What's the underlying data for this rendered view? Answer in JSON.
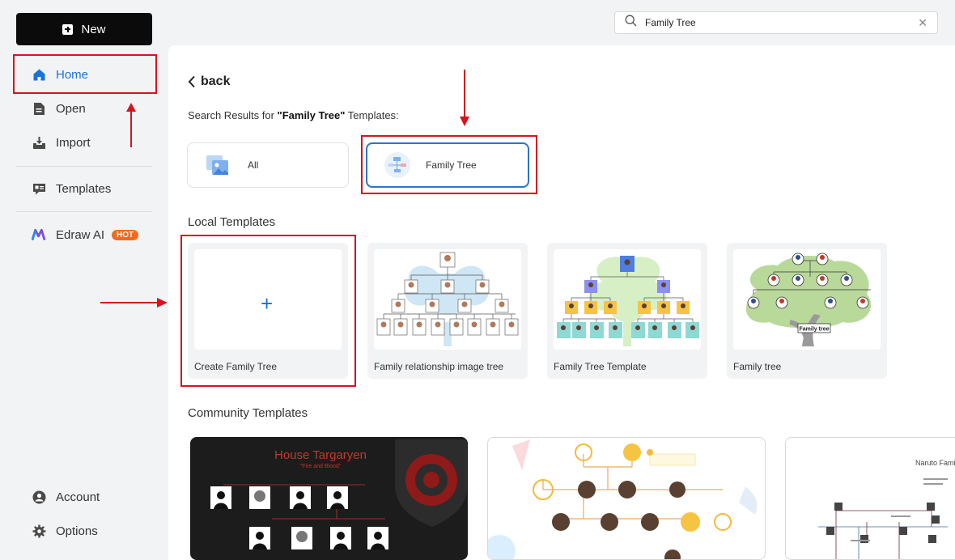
{
  "sidebar": {
    "new_label": "New",
    "items": [
      {
        "label": "Home",
        "icon": "home-icon"
      },
      {
        "label": "Open",
        "icon": "open-icon"
      },
      {
        "label": "Import",
        "icon": "import-icon"
      },
      {
        "label": "Templates",
        "icon": "templates-icon"
      },
      {
        "label": "Edraw AI",
        "icon": "edraw-ai-icon",
        "badge": "HOT"
      },
      {
        "label": "Account",
        "icon": "account-icon"
      },
      {
        "label": "Options",
        "icon": "gear-icon"
      }
    ]
  },
  "search": {
    "value": "Family Tree"
  },
  "main": {
    "back_label": "back",
    "results_prefix": "Search Results for ",
    "results_query": "\"Family Tree\"",
    "results_suffix": " Templates:",
    "filters": [
      {
        "label": "All"
      },
      {
        "label": "Family Tree",
        "selected": true
      }
    ],
    "local_title": "Local Templates",
    "local_cards": [
      {
        "label": "Create Family Tree"
      },
      {
        "label": "Family relationship image tree"
      },
      {
        "label": "Family Tree Template"
      },
      {
        "label": "Family tree"
      }
    ],
    "community_title": "Community Templates",
    "community_cards": [
      {
        "title": "House Targaryen",
        "subtitle": "\"Fire and Blood\""
      },
      {
        "title": ""
      },
      {
        "title": "Naruto Famil"
      }
    ],
    "tree3_label": "Family tree"
  },
  "colors": {
    "accent": "#1a73d9",
    "annotation": "#d8131e",
    "hot": "#f26b1d"
  }
}
